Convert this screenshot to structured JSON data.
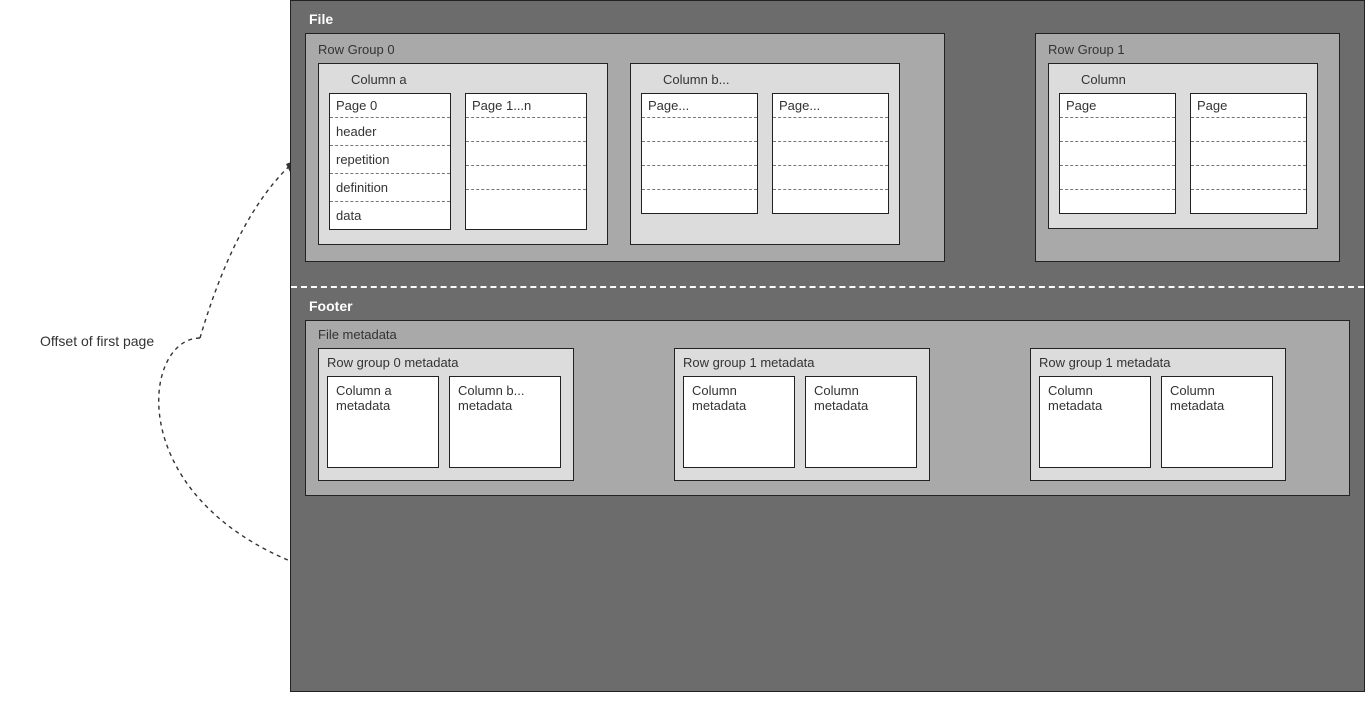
{
  "offset_label": "Offset of first page",
  "file": {
    "label": "File",
    "row_groups": [
      {
        "title": "Row Group 0",
        "columns": [
          {
            "title": "Column a",
            "pages": [
              {
                "title": "Page 0",
                "rows": [
                  "header",
                  "repetition",
                  "definition",
                  "data"
                ]
              },
              {
                "title": "Page 1...n",
                "rows": [
                  "",
                  "",
                  "",
                  ""
                ]
              }
            ]
          },
          {
            "title": "Column b...",
            "pages": [
              {
                "title": "Page...",
                "rows": [
                  "",
                  "",
                  "",
                  ""
                ]
              },
              {
                "title": "Page...",
                "rows": [
                  "",
                  "",
                  "",
                  ""
                ]
              }
            ]
          }
        ]
      },
      {
        "title": "Row Group 1",
        "columns": [
          {
            "title": "Column",
            "pages": [
              {
                "title": "Page",
                "rows": [
                  "",
                  "",
                  "",
                  ""
                ]
              },
              {
                "title": "Page",
                "rows": [
                  "",
                  "",
                  "",
                  ""
                ]
              }
            ]
          }
        ]
      }
    ]
  },
  "footer": {
    "label": "Footer",
    "file_metadata": {
      "title": "File metadata",
      "row_group_meta": [
        {
          "title": "Row group 0 metadata",
          "columns": [
            "Column a metadata",
            "Column b... metadata"
          ]
        },
        {
          "title": "Row group 1 metadata",
          "columns": [
            "Column metadata",
            "Column metadata"
          ]
        },
        {
          "title": "Row group 1 metadata",
          "columns": [
            "Column metadata",
            "Column metadata"
          ]
        }
      ]
    }
  }
}
